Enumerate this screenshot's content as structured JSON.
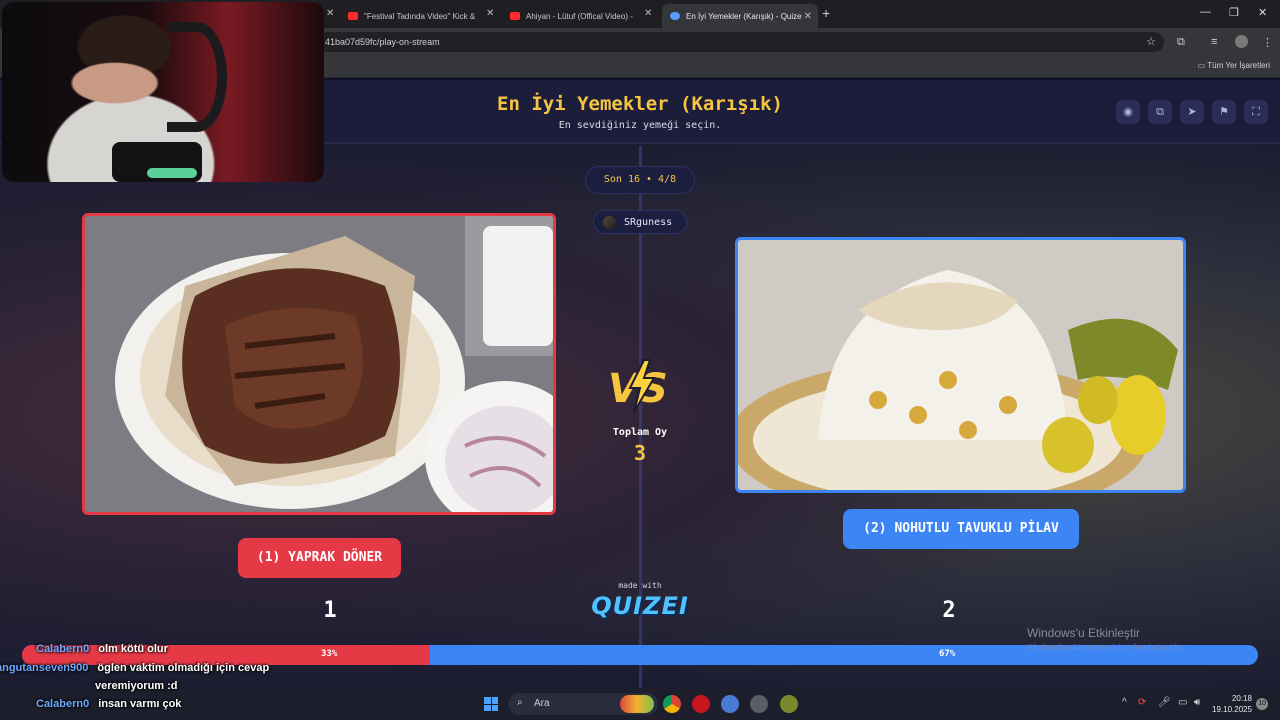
{
  "browser": {
    "tabs": [
      {
        "label": "\"Festival Tadında Video\" Kick &"
      },
      {
        "label": "Ahiyan - Lütuf (Offical Video) -"
      },
      {
        "label": "En İyi Yemekler (Karışık) - Quize"
      }
    ],
    "url": "41ba07d59fc/play-on-stream",
    "bookmarks_label": "Tüm Yer İşaretleri"
  },
  "quiz": {
    "title": "En İyi Yemekler (Karışık)",
    "subtitle": "En sevdiğiniz yemeği seçin.",
    "round": "Son 16 • 4/8",
    "username": "SRguness",
    "total_label": "Toplam Oy",
    "total_votes": "3",
    "left": {
      "label": "(1) YAPRAK DÖNER",
      "votes": "1",
      "percent_label": "33%",
      "percent": 33
    },
    "right": {
      "label": "(2) NOHUTLU TAVUKLU PİLAV",
      "votes": "2",
      "percent_label": "67%",
      "percent": 67
    },
    "made_with": "made with",
    "brand": "QUIZEI",
    "colors": {
      "left": "#e63946",
      "right": "#3d84f5",
      "title": "#f5c542"
    }
  },
  "watermark": {
    "line1": "Windows'u Etkinleştir",
    "line2": "Windows'u etkinleştirmek için Ayarlar'a gidin."
  },
  "chat": [
    {
      "user": "Calabern0",
      "text": "olm kötü olur"
    },
    {
      "user": "angutanseven900",
      "text": "öglen vaktim olmadığı için cevap"
    },
    {
      "user": "",
      "text": "veremiyorum :d"
    },
    {
      "user": "Calabern0",
      "text": "insan varmı çok"
    }
  ],
  "taskbar": {
    "search_label": "Ara",
    "time": "20:18",
    "date": "19.10.2025",
    "notifications": "10"
  }
}
